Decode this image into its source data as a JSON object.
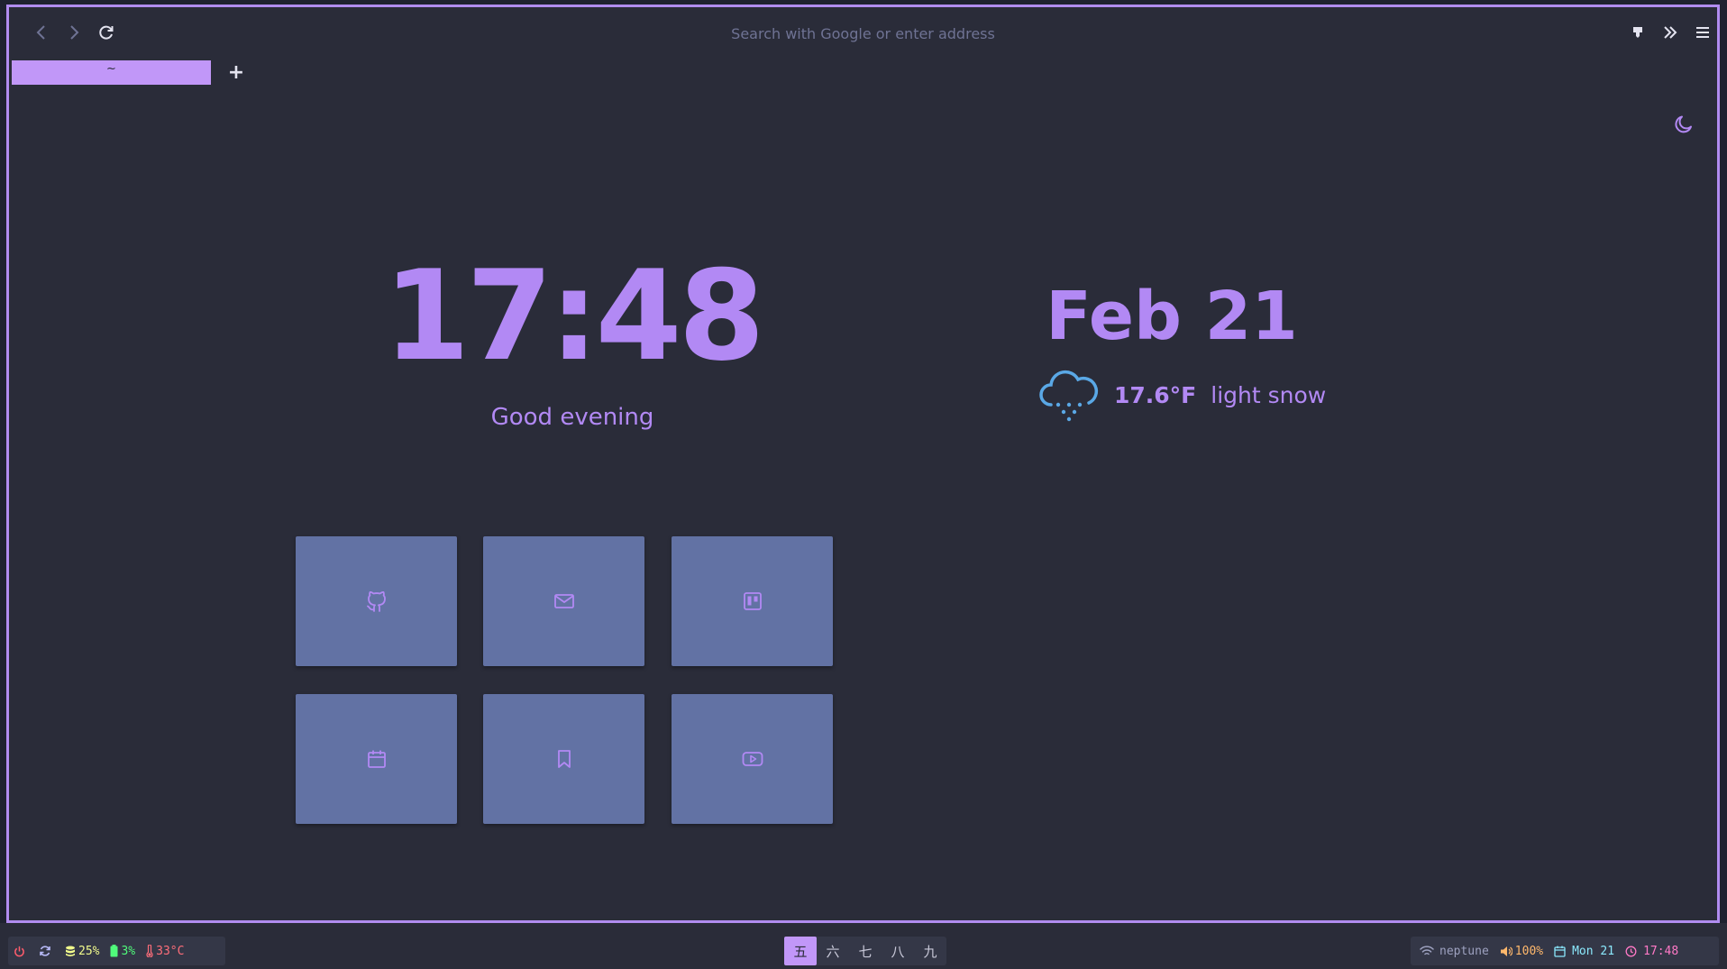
{
  "browser": {
    "url_placeholder": "Search with Google or enter address",
    "active_tab_title": "~",
    "new_tab_label": "+"
  },
  "newtab": {
    "time": "17:48",
    "greeting": "Good evening",
    "date": "Feb 21",
    "weather": {
      "temperature": "17.6°F",
      "condition": "light snow",
      "icon": "cloud-snow-icon"
    },
    "tiles": [
      {
        "icon": "github-icon"
      },
      {
        "icon": "mail-icon"
      },
      {
        "icon": "trello-icon"
      },
      {
        "icon": "calendar-icon"
      },
      {
        "icon": "bookmark-icon"
      },
      {
        "icon": "youtube-icon"
      }
    ]
  },
  "statusbar": {
    "left": {
      "power_icon": "power-icon",
      "sync_icon": "refresh-icon",
      "storage": "25%",
      "battery": "3%",
      "temperature": "33°C"
    },
    "workspaces": [
      "五",
      "六",
      "七",
      "八",
      "九"
    ],
    "active_workspace": "五",
    "right": {
      "network": "neptune",
      "volume": "100%",
      "date": "Mon 21",
      "time": "17:48"
    }
  },
  "colors": {
    "accent": "#b289f4",
    "tile": "#6272a4",
    "background": "#2a2c39",
    "weather_icon": "#5aa8e6"
  }
}
